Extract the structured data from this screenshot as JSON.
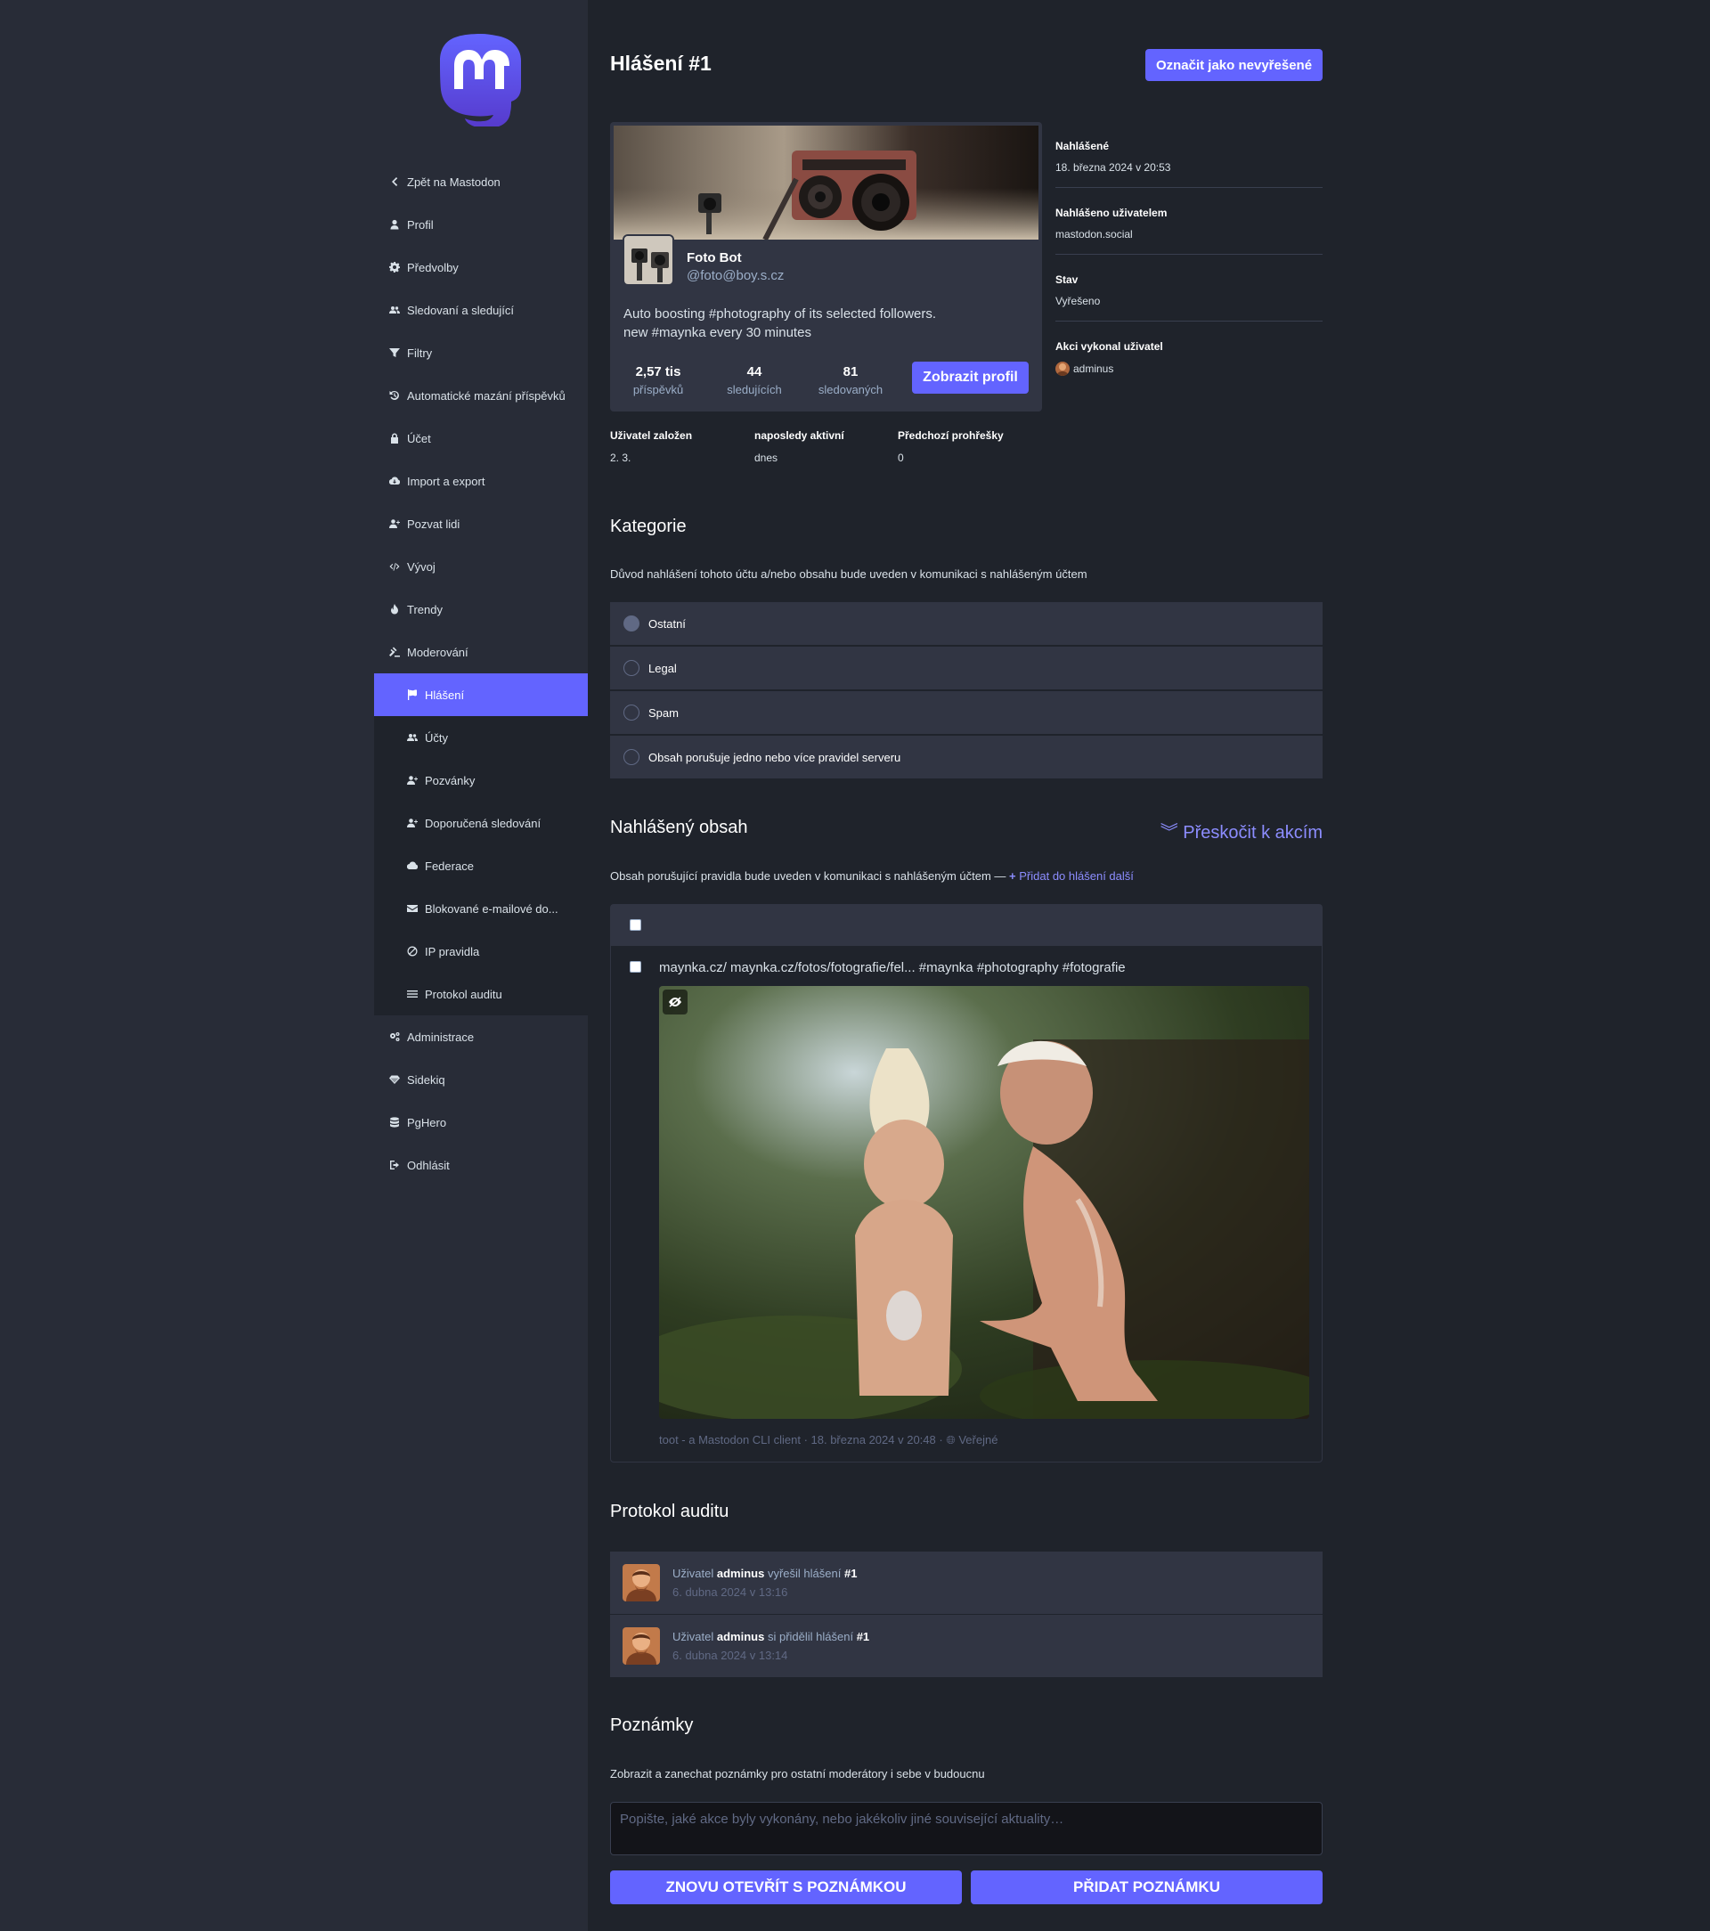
{
  "colors": {
    "accent": "#6364ff",
    "link": "#8c8dff",
    "sidebar_bg": "#282c37",
    "content_bg": "#1f232b"
  },
  "sidebar": {
    "items": [
      {
        "label": "Zpět na Mastodon",
        "icon": "chevron-left-icon"
      },
      {
        "label": "Profil",
        "icon": "user-icon"
      },
      {
        "label": "Předvolby",
        "icon": "gear-icon"
      },
      {
        "label": "Sledovaní a sledující",
        "icon": "users-icon"
      },
      {
        "label": "Filtry",
        "icon": "filter-icon"
      },
      {
        "label": "Automatické mazání příspěvků",
        "icon": "history-icon"
      },
      {
        "label": "Účet",
        "icon": "lock-icon"
      },
      {
        "label": "Import a export",
        "icon": "cloud-download-icon"
      },
      {
        "label": "Pozvat lidi",
        "icon": "user-plus-icon"
      },
      {
        "label": "Vývoj",
        "icon": "code-icon"
      },
      {
        "label": "Trendy",
        "icon": "fire-icon"
      },
      {
        "label": "Moderování",
        "icon": "gavel-icon"
      }
    ],
    "moderation": [
      {
        "label": "Hlášení",
        "icon": "flag-icon"
      },
      {
        "label": "Účty",
        "icon": "users-icon"
      },
      {
        "label": "Pozvánky",
        "icon": "user-plus-icon"
      },
      {
        "label": "Doporučená sledování",
        "icon": "user-plus-icon"
      },
      {
        "label": "Federace",
        "icon": "cloud-icon"
      },
      {
        "label": "Blokované e-mailové do...",
        "icon": "envelope-icon"
      },
      {
        "label": "IP pravidla",
        "icon": "ban-icon"
      },
      {
        "label": "Protokol auditu",
        "icon": "list-icon"
      }
    ],
    "bottom": [
      {
        "label": "Administrace",
        "icon": "cogs-icon"
      },
      {
        "label": "Sidekiq",
        "icon": "diamond-icon"
      },
      {
        "label": "PgHero",
        "icon": "database-icon"
      },
      {
        "label": "Odhlásit",
        "icon": "sign-out-icon"
      }
    ]
  },
  "page": {
    "title": "Hlášení #1",
    "unresolve_button": "Označit jako nevyřešené"
  },
  "account": {
    "name": "Foto Bot",
    "handle": "@foto@boy.s.cz",
    "bio_line1": "Auto boosting #photography of its selected followers.",
    "bio_line2": "new #maynka every 30 minutes",
    "stats": [
      {
        "num": "2,57 tis",
        "label": "příspěvků"
      },
      {
        "num": "44",
        "label": "sledujících"
      },
      {
        "num": "81",
        "label": "sledovaných"
      }
    ],
    "view_profile": "Zobrazit profil"
  },
  "report_info": [
    {
      "label": "Nahlášené",
      "value": "18. března 2024 v 20:53"
    },
    {
      "label": "Nahlášeno uživatelem",
      "value": "mastodon.social"
    },
    {
      "label": "Stav",
      "value": "Vyřešeno"
    },
    {
      "label": "Akci vykonal uživatel",
      "value": "adminus"
    }
  ],
  "account_meta": [
    {
      "label": "Uživatel založen",
      "value": "2. 3."
    },
    {
      "label": "naposledy aktivní",
      "value": "dnes"
    },
    {
      "label": "Předchozí prohřešky",
      "value": "0"
    }
  ],
  "category": {
    "title": "Kategorie",
    "hint": "Důvod nahlášení tohoto účtu a/nebo obsahu bude uveden v komunikaci s nahlášeným účtem",
    "options": [
      "Ostatní",
      "Legal",
      "Spam",
      "Obsah porušuje jedno nebo více pravidel serveru"
    ],
    "selected": "Ostatní"
  },
  "reported_content": {
    "title": "Nahlášený obsah",
    "skip": "Přeskočit k akcím",
    "hint": "Obsah porušující pravidla bude uveden v komunikaci s nahlášeným účtem —",
    "add_more": "Přidat do hlášení další",
    "status_text": "maynka.cz/ maynka.cz/fotos/fotografie/fel... #maynka #photography #fotografie",
    "status_meta": "toot - a Mastodon CLI client · 18. března 2024 v 20:48 ·",
    "visibility": "Veřejné"
  },
  "audit": {
    "title": "Protokol auditu",
    "entries": [
      {
        "prefix": "Uživatel",
        "user": "adminus",
        "action": "vyřešil hlášení",
        "target": "#1",
        "date": "6. dubna 2024 v 13:16"
      },
      {
        "prefix": "Uživatel",
        "user": "adminus",
        "action": "si přidělil hlášení",
        "target": "#1",
        "date": "6. dubna 2024 v 13:14"
      }
    ]
  },
  "notes": {
    "title": "Poznámky",
    "hint": "Zobrazit a zanechat poznámky pro ostatní moderátory i sebe v budoucnu",
    "placeholder": "Popište, jaké akce byly vykonány, nebo jakékoliv jiné související aktuality…",
    "reopen_button": "Znovu otevřít s poznámkou",
    "add_button": "Přidat poznámku"
  }
}
